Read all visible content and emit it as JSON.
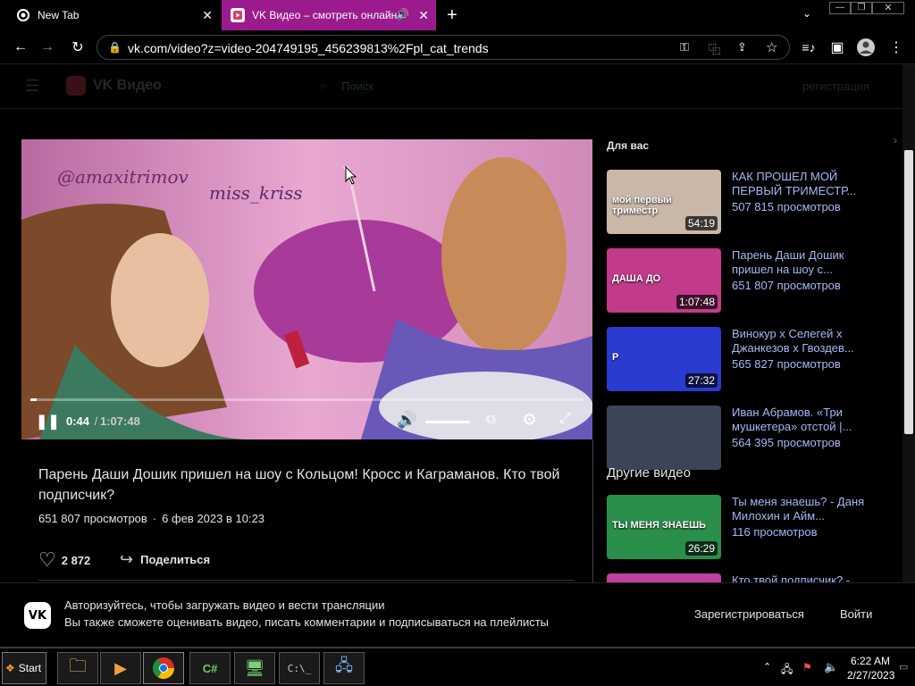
{
  "browser": {
    "tabs": [
      {
        "label": "New Tab"
      },
      {
        "label": "VK Видео – смотреть онлайн"
      }
    ],
    "url": "vk.com/video?z=video-204749195_456239813%2Fpl_cat_trends"
  },
  "vk": {
    "logo_text": "VK Видео",
    "search_label": "Поиск",
    "register_link": "регистрация"
  },
  "player": {
    "time_current": "0:44",
    "time_sep": " / ",
    "time_total": "1:07:48",
    "progress": 0.0108,
    "graffiti_text": "@amaxitrimov",
    "graffiti_text2": "miss_kriss"
  },
  "video": {
    "title": "Парень Даши Дошик пришел на шоу с Кольцом! Кросс и Каграманов. Кто твой подписчик?",
    "views": "651 807 просмотров",
    "dot": "·",
    "date": "6 фев 2023 в 10:23",
    "likes": "2 872",
    "share_label": "Поделиться"
  },
  "sidebar": {
    "for_you_label": "Для вас",
    "others_label": "Другие видео",
    "for_you": [
      {
        "title": "КАК ПРОШЕЛ МОЙ ПЕРВЫЙ ТРИМЕСТР...",
        "views": "507 815 просмотров",
        "duration": "54:19",
        "thumb_text": "мой первый триместр",
        "color": "#c9b7a8"
      },
      {
        "title": "Парень Даши Дошик пришел на шоу с...",
        "views": "651 807 просмотров",
        "duration": "1:07:48",
        "thumb_text": "ДАША ДО",
        "color": "#c23a8a"
      },
      {
        "title": "Винокур x Селегей x Джанкезов x Гвоздев...",
        "views": "565 827 просмотров",
        "duration": "27:32",
        "thumb_text": "P",
        "color": "#2a3bd0"
      },
      {
        "title": "Иван Абрамов. «Три мушкетера» отстой |...",
        "views": "564 395 просмотров",
        "duration": "",
        "thumb_text": "",
        "color": "#3a4656"
      }
    ],
    "others": [
      {
        "title": "Ты меня знаешь? - Даня Милохин и Айм...",
        "views": "116 просмотров",
        "duration": "26:29",
        "thumb_text": "ТЫ МЕНЯ ЗНАЕШЬ",
        "color": "#2a8f4a"
      },
      {
        "title": "Кто твой подписчик? -",
        "views": "",
        "duration": "",
        "thumb_text": "",
        "color": "#c040a0"
      }
    ]
  },
  "banner": {
    "title": "Авторизуйтесь, чтобы загружать видео и вести трансляции",
    "subtitle": "Вы также сможете оценивать видео, писать комментарии и подписываться на плейлисты",
    "register_button": "Зарегистрироваться",
    "login_button": "Войти"
  },
  "taskbar": {
    "start_label": "Start",
    "time": "6:22 AM",
    "date": "2/27/2023"
  },
  "colors": {
    "link": "#a7b7f5",
    "active_tab": "#9b1b8e",
    "vk_blue": "#0077ff"
  }
}
